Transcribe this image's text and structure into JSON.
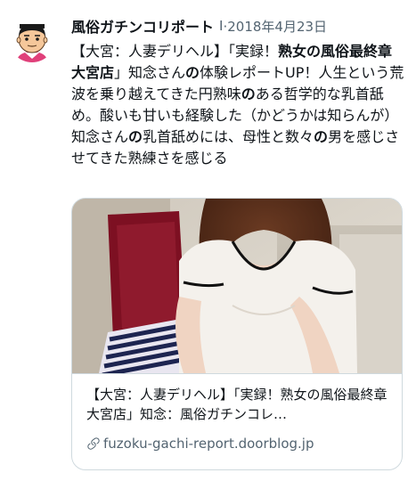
{
  "tweet": {
    "author": {
      "display_name": "風俗ガチンコリポート",
      "separator": "I",
      "date": "2018年4月23日"
    },
    "text_segments": [
      {
        "text": "【大宮：人妻デリヘル】「実録！",
        "bold": false
      },
      {
        "text": "熟女の風俗最終章 大宮店",
        "bold": true
      },
      {
        "text": "」知念さん",
        "bold": false
      },
      {
        "text": "の",
        "bold": true
      },
      {
        "text": "体験レポートUP！人生という荒波を乗り越えてきた円熟味",
        "bold": false
      },
      {
        "text": "の",
        "bold": true
      },
      {
        "text": "ある哲学的な乳首舐め。酸いも甘いも経験した（かどうかは知らんが）知念さん",
        "bold": false
      },
      {
        "text": "の",
        "bold": true
      },
      {
        "text": "乳首舐めには、母性と数々",
        "bold": false
      },
      {
        "text": "の",
        "bold": true
      },
      {
        "text": "男を感じさせてきた熟練さを感じる",
        "bold": false
      }
    ],
    "card": {
      "title": "【大宮：人妻デリヘル】「実録！熟女の風俗最終章 大宮店」知念：風俗ガチンコレ…",
      "domain": "fuzoku-gachi-report.doorblog.jp"
    }
  },
  "icons": {
    "avatar": "cartoon-avatar-icon",
    "link": "link-icon"
  },
  "colors": {
    "text_primary": "#0f1419",
    "text_secondary": "#536471",
    "border": "#cfd9de"
  }
}
